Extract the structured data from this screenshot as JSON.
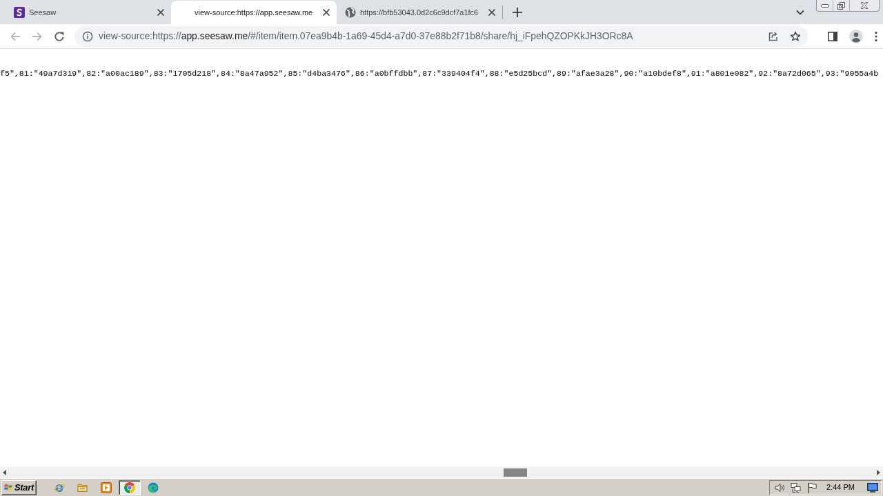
{
  "browser": {
    "tabs": [
      {
        "title": "Seesaw",
        "kind": "logo",
        "selected": false
      },
      {
        "title": "view-source:https://app.seesaw.me",
        "kind": "blank",
        "selected": true
      },
      {
        "title": "https://bfb53043.0d2c6c9dcf7a1fc6",
        "kind": "globe",
        "selected": false
      }
    ],
    "nav_buttons": [
      {
        "kind": "back",
        "disabled": true
      },
      {
        "kind": "forward",
        "disabled": true
      },
      {
        "kind": "reload",
        "disabled": false
      }
    ],
    "address": {
      "scheme": "view-source:https://",
      "host": "app.seesaw.me",
      "path": "/#/item/item.07ea9b4b-1a69-45d4-a7d0-37e88b2f71b8/share/hj_iFpehQZOPKkJH3ORc8A"
    }
  },
  "page": {
    "source_line": "f5\",81:\"49a7d319\",82:\"a00ac189\",83:\"1705d218\",84:\"8a47a952\",85:\"d4ba3476\",86:\"a0bffdbb\",87:\"339404f4\",88:\"e5d25bcd\",89:\"afae3a28\",90:\"a10bdef8\",91:\"a801e082\",92:\"8a72d065\",93:\"9055a4b"
  },
  "taskbar": {
    "start": "Start",
    "apps": [
      {
        "kind": "orbit",
        "selected": false
      },
      {
        "kind": "folder",
        "selected": false
      },
      {
        "kind": "player",
        "selected": false
      },
      {
        "kind": "ring",
        "selected": true
      },
      {
        "kind": "swirl",
        "selected": false
      }
    ],
    "clock": "2:44 PM"
  }
}
